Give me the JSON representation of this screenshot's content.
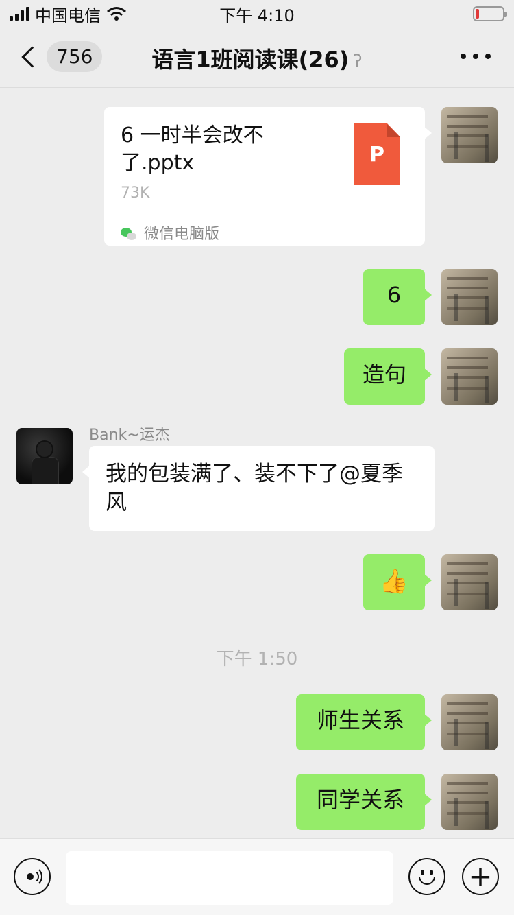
{
  "status_bar": {
    "carrier": "中国电信",
    "time": "下午 4:10",
    "icons": [
      "signal-icon",
      "wifi-icon",
      "battery-icon"
    ]
  },
  "header": {
    "back_badge": "756",
    "title": "语言1班阅读课(26)",
    "ear_icon": "ear-icon",
    "more_icon": "more-icon"
  },
  "messages": {
    "file": {
      "name": "6 一时半会改不了.pptx",
      "size": "73K",
      "type_letter": "P",
      "source": "微信电脑版"
    },
    "msg_6": "6",
    "msg_zaoju": "造句",
    "incoming": {
      "sender": "Bank~运杰",
      "text": "我的包装满了、装不下了@夏季风"
    },
    "thumbs_up": "👍",
    "time_divider": "下午 1:50",
    "msg_shisheng": "师生关系",
    "msg_tongxue": "同学关系"
  },
  "input_bar": {
    "placeholder": "",
    "icons": [
      "voice-icon",
      "emoji-icon",
      "plus-icon"
    ]
  },
  "colors": {
    "bg": "#ededed",
    "bubble_green": "#95ec69",
    "bubble_white": "#ffffff",
    "ppt_orange": "#f05a3c"
  }
}
